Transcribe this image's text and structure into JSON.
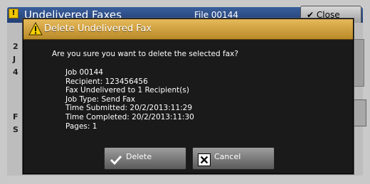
{
  "background": {
    "title": "Undelivered Faxes",
    "file": "File 00144",
    "close_label": "Close",
    "side_fragments": [
      "2",
      "J",
      "4",
      "F",
      "S"
    ]
  },
  "dialog": {
    "title": "Delete Undelivered Fax",
    "question": "Are you sure you want to delete the selected fax?",
    "details": [
      "Job 00144",
      "Recipient: 123456456",
      "Fax Undelivered to 1 Recipient(s)",
      "Job Type: Send Fax",
      "Time Submitted: 20/2/2013:11:29",
      "Time Completed: 20/2/2013:11:30",
      "Pages: 1"
    ],
    "delete_label": "Delete",
    "cancel_label": "Cancel"
  },
  "icons": {
    "warning": "warning-icon",
    "check": "checkmark-icon",
    "cancel": "x-icon"
  }
}
